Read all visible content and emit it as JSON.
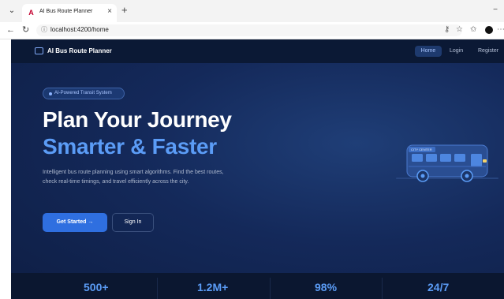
{
  "browser": {
    "tab_title": "AI Bus Route Planner",
    "tab_close": "×",
    "new_tab": "+",
    "address": "localhost:4200/home",
    "minimize": "−"
  },
  "site": {
    "brand": "AI Bus Route Planner",
    "nav": {
      "home": "Home",
      "login": "Login",
      "register": "Register"
    }
  },
  "hero": {
    "badge": "AI-Powered Transit System",
    "title_line1": "Plan Your Journey",
    "title_line2": "Smarter & Faster",
    "description": "Intelligent bus route planning using smart algorithms. Find the best routes, check real-time timings, and travel efficiently across the city.",
    "primary_button": "Get Started →",
    "secondary_button": "Sign In",
    "bus_sign": "CITY CENTER"
  },
  "stats": [
    "500+",
    "1.2M+",
    "98%",
    "24/7"
  ],
  "colors": {
    "accent": "#5b9cf6",
    "primary_button": "#2f6fe0",
    "navbar": "#0b1935",
    "hero_background": "#14295a"
  }
}
